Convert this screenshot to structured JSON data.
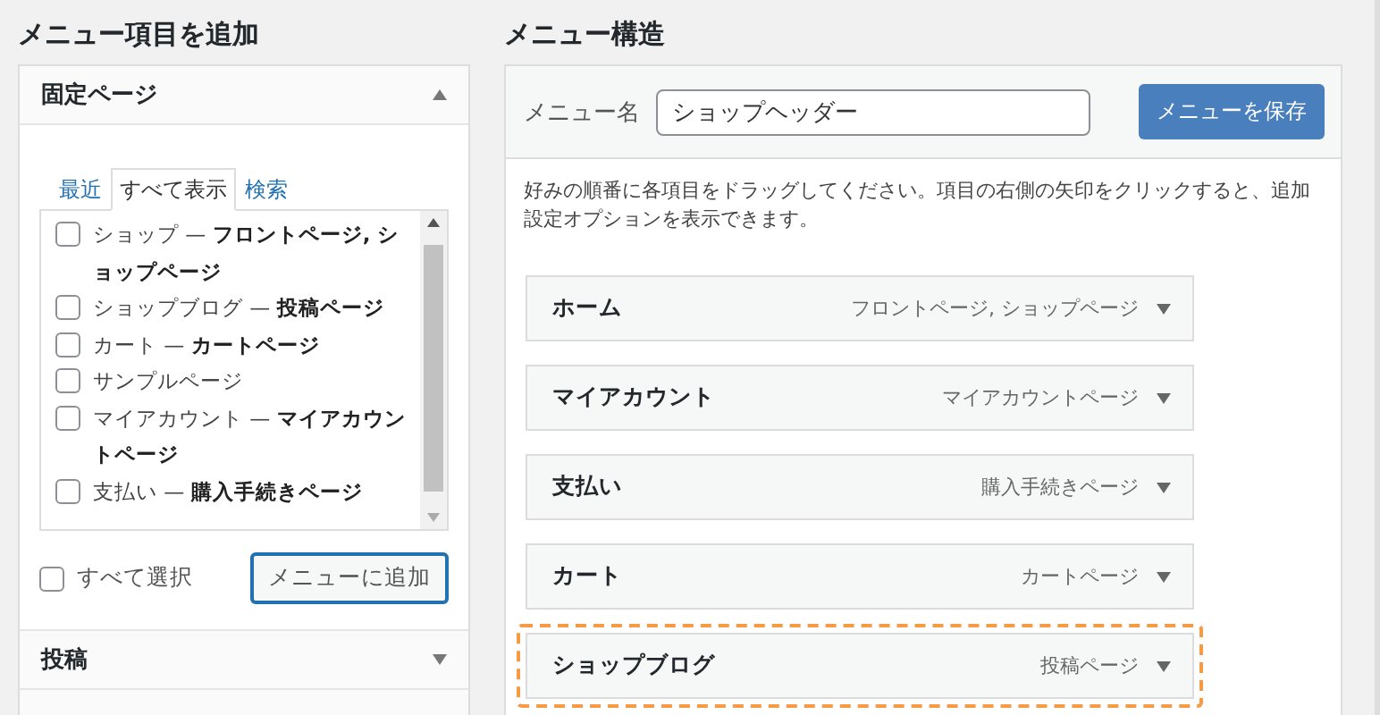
{
  "add_panel": {
    "title": "メニュー項目を追加",
    "sections": [
      {
        "title": "固定ページ",
        "expanded": true
      },
      {
        "title": "投稿",
        "expanded": false
      }
    ],
    "tabs": [
      {
        "label": "最近",
        "selected": false
      },
      {
        "label": "すべて表示",
        "selected": true
      },
      {
        "label": "検索",
        "selected": false
      }
    ],
    "pages": [
      {
        "label": "ショップ — **フロントページ, ショップページ**",
        "checked": false
      },
      {
        "label": "ショップブログ — **投稿ページ**",
        "checked": false
      },
      {
        "label": "カート — **カートページ**",
        "checked": false
      },
      {
        "label": "サンプルページ",
        "checked": false
      },
      {
        "label": "マイアカウント — **マイアカウントページ**",
        "checked": false
      },
      {
        "label": "支払い — **購入手続きページ**",
        "checked": false
      }
    ],
    "select_all": {
      "label": "すべて選択",
      "checked": false
    },
    "add_button": "メニューに追加"
  },
  "structure": {
    "title": "メニュー構造",
    "name_label": "メニュー名",
    "name_value": "ショップヘッダー",
    "save_button": "メニューを保存",
    "instructions": "好みの順番に各項目をドラッグしてください。項目の右側の矢印をクリックすると、追加設定オプションを表示できます。",
    "items": [
      {
        "title": "ホーム",
        "type": "フロントページ, ショップページ",
        "highlighted": false
      },
      {
        "title": "マイアカウント",
        "type": "マイアカウントページ",
        "highlighted": false
      },
      {
        "title": "支払い",
        "type": "購入手続きページ",
        "highlighted": false
      },
      {
        "title": "カート",
        "type": "カートページ",
        "highlighted": false
      },
      {
        "title": "ショップブログ",
        "type": "投稿ページ",
        "highlighted": true
      }
    ]
  }
}
